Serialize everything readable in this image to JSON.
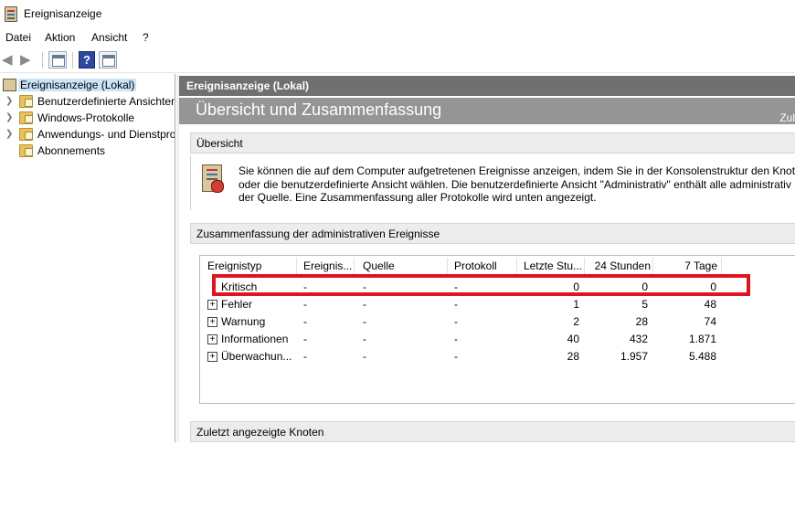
{
  "window": {
    "title": "Ereignisanzeige"
  },
  "menu": [
    "Datei",
    "Aktion",
    "Ansicht",
    "?"
  ],
  "toolbar": {
    "back_icon": "arrow-left-icon",
    "forward_icon": "arrow-right-icon",
    "help_label": "?"
  },
  "tree": {
    "root": "Ereignisanzeige (Lokal)",
    "items": [
      "Benutzerdefinierte Ansichten",
      "Windows-Protokolle",
      "Anwendungs- und Dienstprotokolle",
      "Abonnements"
    ]
  },
  "main": {
    "header": "Ereignisanzeige (Lokal)",
    "banner": "Übersicht und Zusammenfassung",
    "banner_right": "Zul",
    "overview": {
      "title": "Übersicht",
      "line1": "Sie können die auf dem Computer aufgetretenen Ereignisse anzeigen, indem Sie in der Konsolenstruktur den Knoten",
      "line2": "oder die benutzerdefinierte Ansicht wählen. Die benutzerdefinierte Ansicht \"Administrativ\" enthält alle administrativ",
      "line3": "der Quelle. Eine Zusammenfassung aller Protokolle wird unten angezeigt."
    },
    "summary": {
      "title": "Zusammenfassung der administrativen Ereignisse",
      "columns": [
        "Ereignistyp",
        "Ereignis...",
        "Quelle",
        "Protokoll",
        "Letzte Stu...",
        "24 Stunden",
        "7 Tage"
      ],
      "rows": [
        {
          "type": "Kritisch",
          "event_id": "-",
          "source": "-",
          "log": "-",
          "last_hour": "0",
          "h24": "0",
          "d7": "0",
          "expandable": false
        },
        {
          "type": "Fehler",
          "event_id": "-",
          "source": "-",
          "log": "-",
          "last_hour": "1",
          "h24": "5",
          "d7": "48",
          "expandable": true
        },
        {
          "type": "Warnung",
          "event_id": "-",
          "source": "-",
          "log": "-",
          "last_hour": "2",
          "h24": "28",
          "d7": "74",
          "expandable": true
        },
        {
          "type": "Informationen",
          "event_id": "-",
          "source": "-",
          "log": "-",
          "last_hour": "40",
          "h24": "432",
          "d7": "1.871",
          "expandable": true
        },
        {
          "type": "Überwachun...",
          "event_id": "-",
          "source": "-",
          "log": "-",
          "last_hour": "28",
          "h24": "1.957",
          "d7": "5.488",
          "expandable": true
        }
      ]
    },
    "recent_nodes": {
      "title": "Zuletzt angezeigte Knoten"
    }
  },
  "colors": {
    "highlight": "#e0141e",
    "header_bg": "#707070",
    "banner_bg": "#959595",
    "selection": "#cce4f7"
  }
}
